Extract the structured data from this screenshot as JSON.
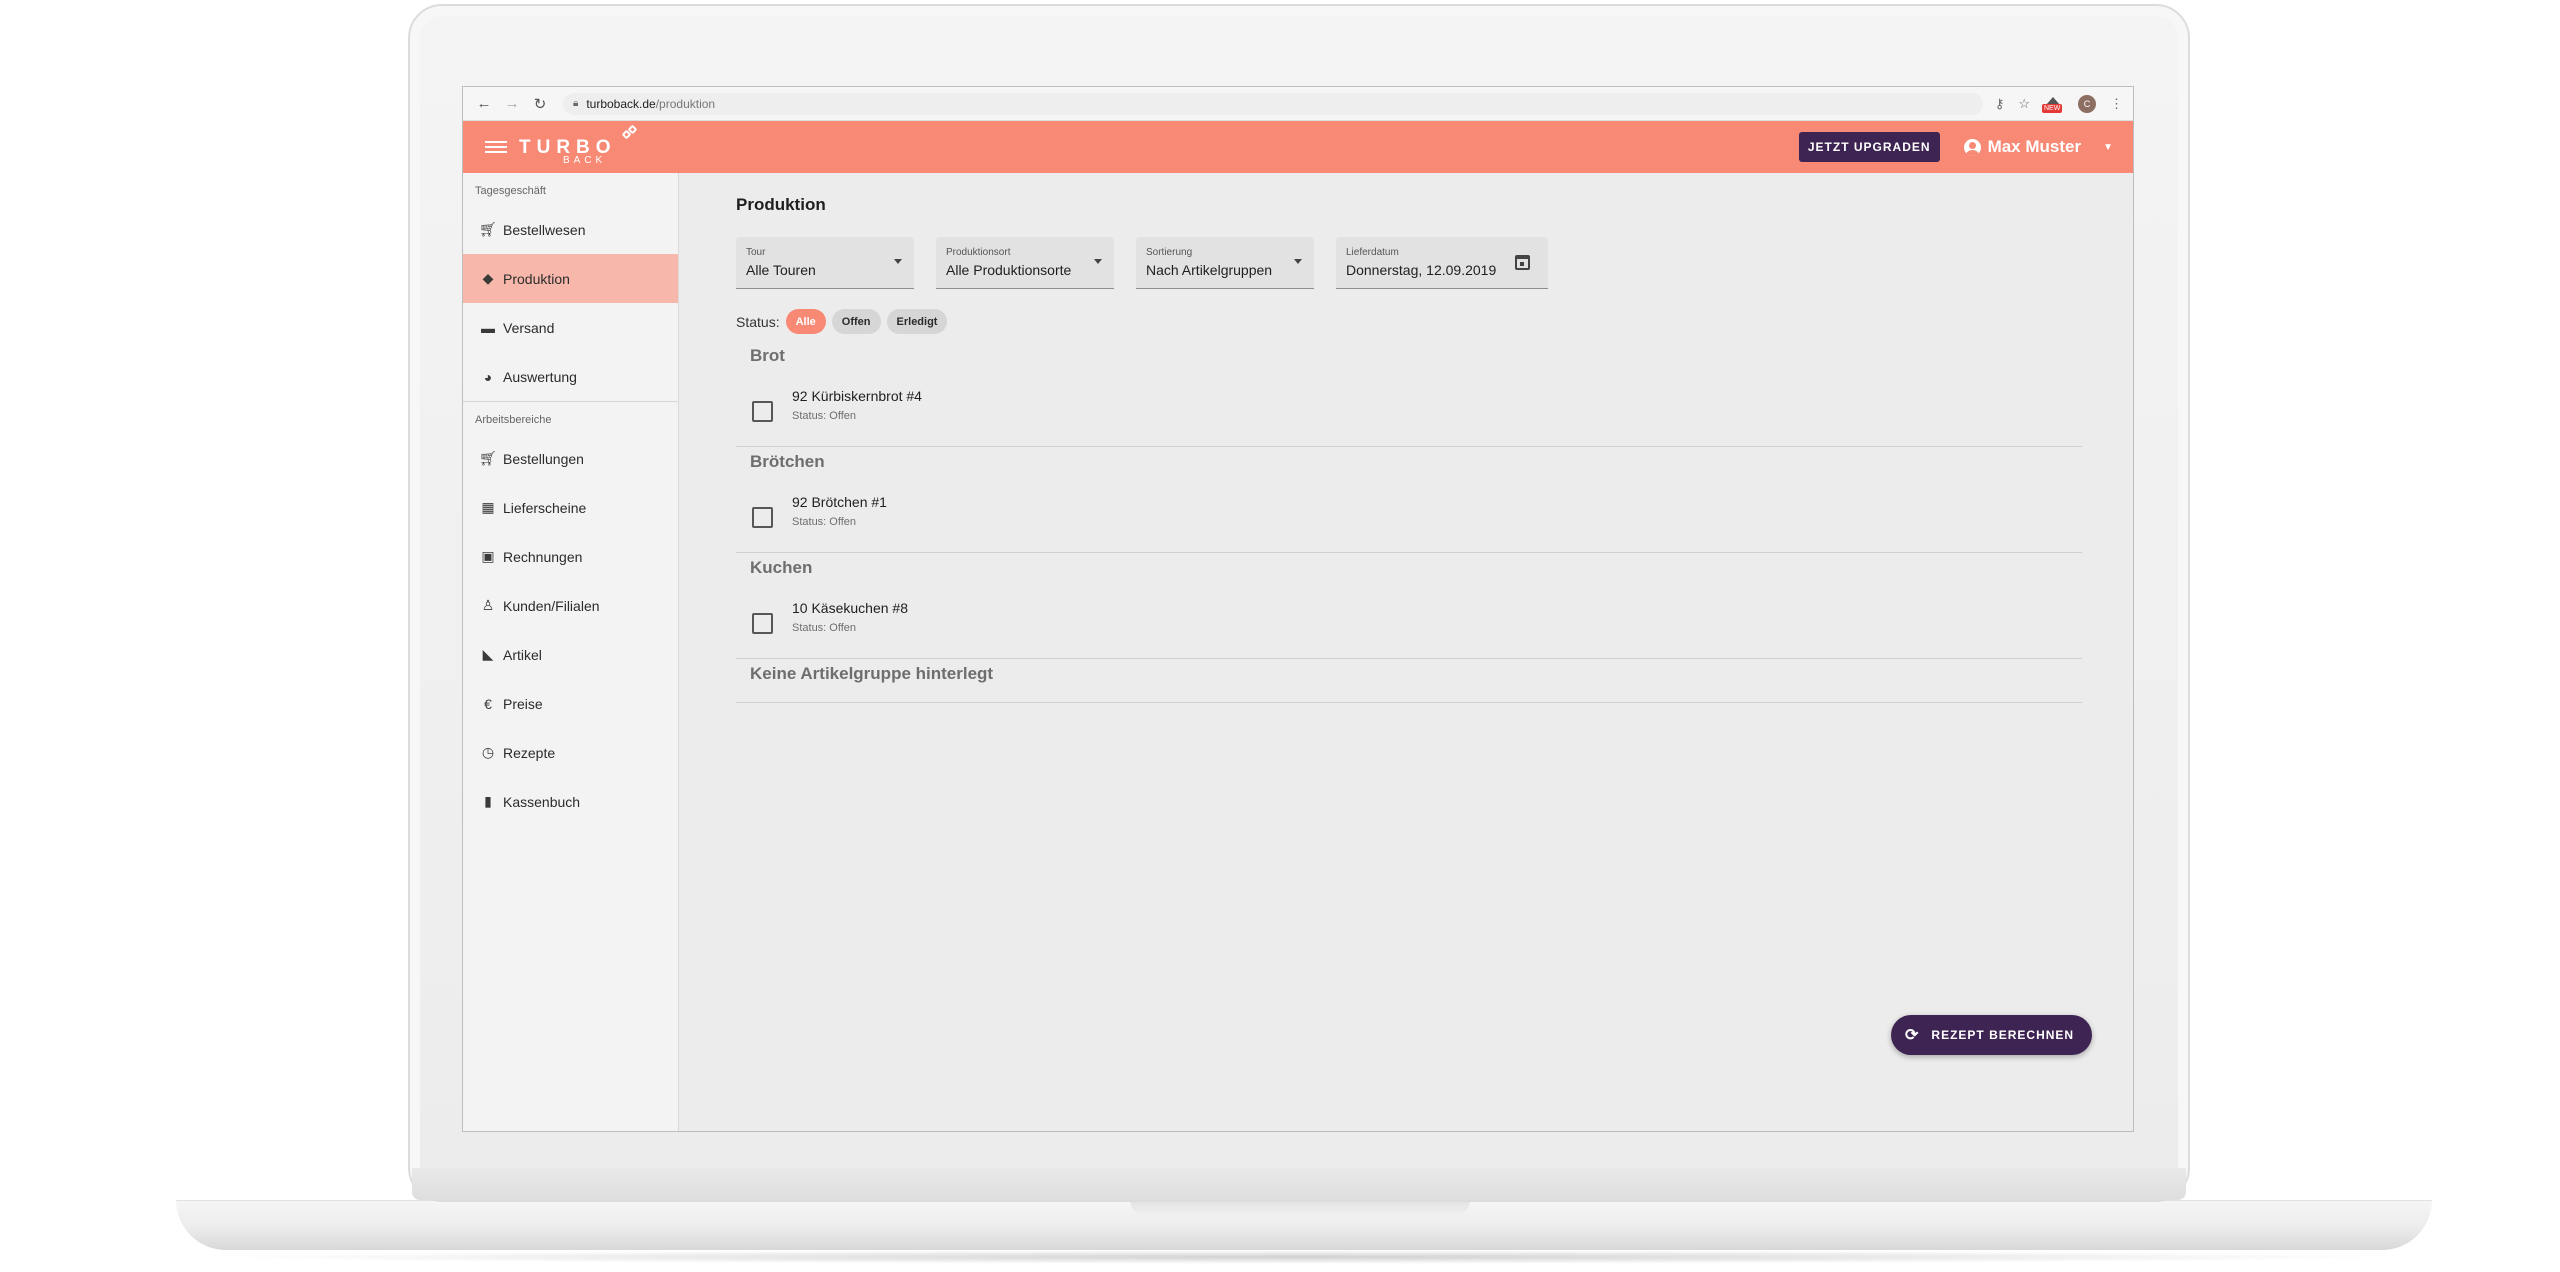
{
  "browser": {
    "url_host": "turboback.de",
    "url_path": "/produktion",
    "ext_badge": "NEW",
    "profile_initial": "C"
  },
  "appbar": {
    "logo_main": "TURBO",
    "logo_sub": "BACK",
    "upgrade_label": "JETZT UPGRADEN",
    "user_name": "Max Muster"
  },
  "sidebar": {
    "section1": "Tagesgeschäft",
    "section1_items": [
      {
        "label": "Bestellwesen",
        "icon": "cart-icon"
      },
      {
        "label": "Produktion",
        "icon": "bread-icon"
      },
      {
        "label": "Versand",
        "icon": "truck-icon"
      },
      {
        "label": "Auswertung",
        "icon": "pie-chart-icon"
      }
    ],
    "section2": "Arbeitsbereiche",
    "section2_items": [
      {
        "label": "Bestellungen",
        "icon": "cart-icon"
      },
      {
        "label": "Lieferscheine",
        "icon": "calendar-icon"
      },
      {
        "label": "Rechnungen",
        "icon": "wallet-icon"
      },
      {
        "label": "Kunden/Filialen",
        "icon": "person-icon"
      },
      {
        "label": "Artikel",
        "icon": "tag-icon"
      },
      {
        "label": "Preise",
        "icon": "euro-icon"
      },
      {
        "label": "Rezepte",
        "icon": "clock-icon"
      },
      {
        "label": "Kassenbuch",
        "icon": "book-icon"
      }
    ]
  },
  "main": {
    "title": "Produktion",
    "filters": {
      "tour": {
        "label": "Tour",
        "value": "Alle Touren"
      },
      "ort": {
        "label": "Produktionsort",
        "value": "Alle Produktionsorte"
      },
      "sort": {
        "label": "Sortierung",
        "value": "Nach Artikelgruppen"
      },
      "date": {
        "label": "Lieferdatum",
        "value": "Donnerstag, 12.09.2019"
      }
    },
    "status_label": "Status:",
    "chips": [
      "Alle",
      "Offen",
      "Erledigt"
    ],
    "groups": [
      {
        "title": "Brot",
        "item": {
          "name": "92 Kürbiskernbrot #4",
          "status": "Status: Offen"
        }
      },
      {
        "title": "Brötchen",
        "item": {
          "name": "92 Brötchen #1",
          "status": "Status: Offen"
        }
      },
      {
        "title": "Kuchen",
        "item": {
          "name": "10 Käsekuchen #8",
          "status": "Status: Offen"
        }
      }
    ],
    "empty_group": "Keine Artikelgruppe hinterlegt",
    "fab_label": "REZEPT BERECHNEN"
  },
  "colors": {
    "accent": "#f88a75",
    "accent_light": "#f7b8ab",
    "primary_dark": "#3d2453"
  }
}
